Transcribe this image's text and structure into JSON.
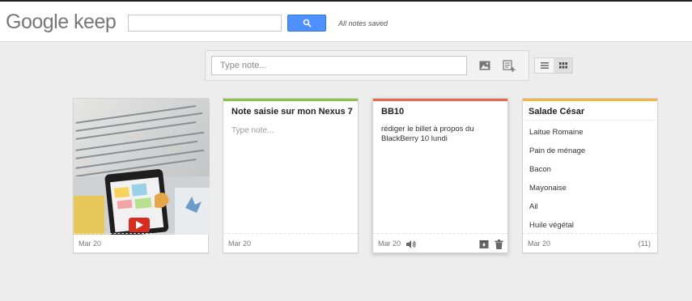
{
  "header": {
    "logo": "Google keep",
    "search_value": "",
    "status": "All notes saved"
  },
  "compose": {
    "placeholder": "Type note..."
  },
  "view": {
    "active": "grid"
  },
  "notes": [
    {
      "type": "photo",
      "date": "Mar 20",
      "accent": "#d3d3d3"
    },
    {
      "type": "text",
      "title": "Note saisie sur mon Nexus 7",
      "body_placeholder": "Type note...",
      "date": "Mar 20",
      "accent": "#8bc34a"
    },
    {
      "type": "text",
      "title": "BB10",
      "body": "rédiger le billet à propos du BlackBerry 10 lundi",
      "date": "Mar 20",
      "accent": "#e5694b"
    },
    {
      "type": "list",
      "title": "Salade César",
      "items": [
        "Laitue Romaine",
        "Pain de ménage",
        "Bacon",
        "Mayonaise",
        "Ail",
        "Huile végétal"
      ],
      "date": "Mar 20",
      "count": "(11)",
      "accent": "#f5b54a"
    }
  ],
  "colors": {
    "search_button": "#4d90fe"
  }
}
